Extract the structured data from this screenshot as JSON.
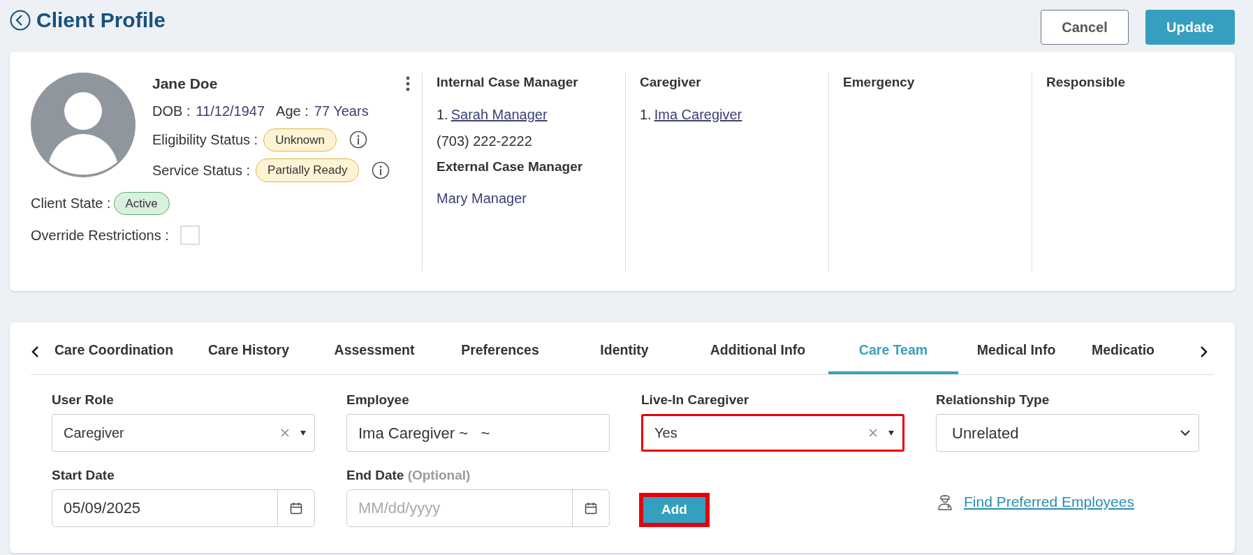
{
  "header": {
    "title": "Client Profile",
    "buttons": [
      {
        "label": "Cancel",
        "kind": "secondary"
      },
      {
        "label": "Update",
        "kind": "primary"
      }
    ]
  },
  "profile": {
    "name": "Jane Doe",
    "dob_label": "DOB :",
    "dob": "11/12/1947",
    "age_label": "Age :",
    "age": "77 Years",
    "statuses": [
      {
        "label": "Eligibility Status :",
        "value": "Unknown",
        "color": "#fff3d6"
      },
      {
        "label": "Service Status :",
        "value": "Partially Ready",
        "color": "#fff3d6"
      }
    ],
    "client_state": {
      "label": "Client State :",
      "value": "Active",
      "color": "#d8f1de"
    },
    "override": {
      "label": "Override Restrictions :",
      "checked": false
    }
  },
  "contacts": [
    {
      "sections": [
        {
          "title": "Internal Case Manager",
          "items": [
            {
              "kind": "link",
              "prefix": "1.",
              "text": "Sarah Manager"
            },
            {
              "kind": "phone",
              "text": "(703) 222-2222"
            }
          ]
        },
        {
          "title": "External Case Manager",
          "items": [
            {
              "kind": "name",
              "text": "Mary Manager"
            }
          ]
        }
      ]
    },
    {
      "sections": [
        {
          "title": "Caregiver",
          "items": [
            {
              "kind": "link",
              "prefix": "1.",
              "text": "Ima Caregiver"
            }
          ]
        }
      ]
    },
    {
      "sections": [
        {
          "title": "Emergency"
        }
      ]
    },
    {
      "sections": [
        {
          "title": "Responsible"
        }
      ]
    }
  ],
  "tabs": [
    {
      "label": "Care Coordination",
      "selected": false
    },
    {
      "label": "Care History",
      "selected": false
    },
    {
      "label": "Assessment",
      "selected": false
    },
    {
      "label": "Preferences",
      "selected": false
    },
    {
      "label": "Identity",
      "selected": false
    },
    {
      "label": "Additional Info",
      "selected": false
    },
    {
      "label": "Care Team",
      "selected": true
    },
    {
      "label": "Medical Info",
      "selected": false
    },
    {
      "label": "Medicatio",
      "selected": false
    }
  ],
  "form": [
    {
      "kind": "select-clear",
      "label": "User Role",
      "value": "Caregiver",
      "highlighted": false
    },
    {
      "kind": "text",
      "label": "Employee",
      "value": "Ima Caregiver ~   ~",
      "highlighted": false
    },
    {
      "kind": "select-clear",
      "label": "Live-In Caregiver",
      "value": "Yes",
      "highlighted": true
    },
    {
      "kind": "select",
      "label": "Relationship Type",
      "value": "Unrelated",
      "highlighted": false
    },
    {
      "kind": "date",
      "label": "Start Date",
      "value": "05/09/2025",
      "highlighted": false
    },
    {
      "kind": "date",
      "label": "End Date",
      "hint": "(Optional)",
      "placeholder": "MM/dd/yyyy",
      "highlighted": false
    },
    {
      "kind": "button",
      "label": "Add",
      "highlighted": true
    },
    {
      "kind": "link",
      "label": "Find Preferred Employees",
      "highlighted": false
    }
  ]
}
